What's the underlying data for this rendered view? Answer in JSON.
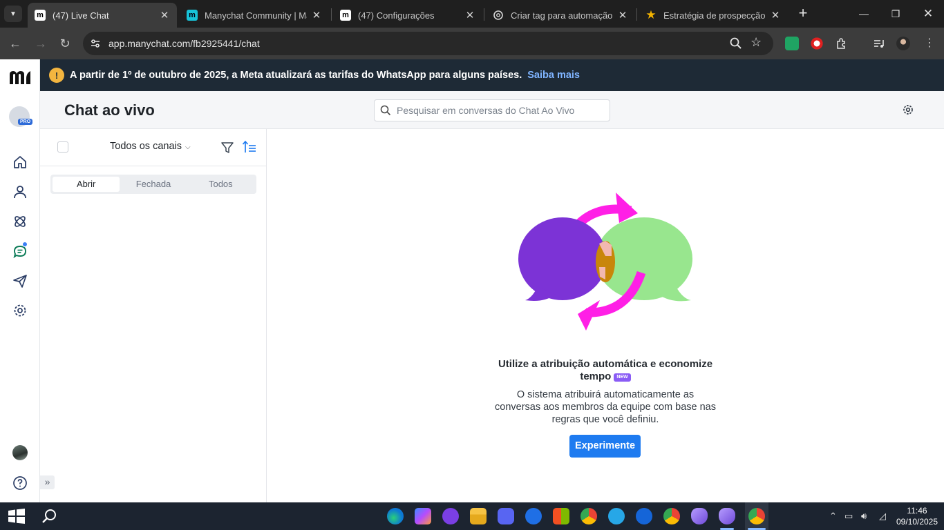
{
  "browser": {
    "tabs": [
      {
        "title": "(47) Live Chat",
        "favicon": "manychat-logo-icon",
        "active": true
      },
      {
        "title": "Manychat Community | Man",
        "favicon": "manychat-community-icon",
        "active": false
      },
      {
        "title": "(47) Configurações",
        "favicon": "manychat-logo-icon",
        "active": false
      },
      {
        "title": "Criar tag para automação",
        "favicon": "chatgpt-icon",
        "active": false
      },
      {
        "title": "Estratégia de prospecção em",
        "favicon": "star-icon",
        "active": false
      }
    ],
    "url": "app.manychat.com/fb2925441/chat",
    "colors": {
      "frame": "#1f1f1f",
      "toolbar": "#3c3c3c"
    }
  },
  "banner": {
    "text": "A partir de 1º de outubro de 2025, a Meta atualizará as tarifas do WhatsApp para alguns países.",
    "link": "Saiba mais"
  },
  "sidebar": {
    "pro_badge": "PRO",
    "items": [
      {
        "name": "home-icon"
      },
      {
        "name": "contacts-icon"
      },
      {
        "name": "automation-icon"
      },
      {
        "name": "live-chat-icon",
        "active": true,
        "notification": true
      },
      {
        "name": "broadcast-icon"
      },
      {
        "name": "settings-icon"
      }
    ]
  },
  "header": {
    "title": "Chat ao vivo",
    "search_placeholder": "Pesquisar em conversas do Chat Ao Vivo"
  },
  "list": {
    "channel_filter": "Todos os canais",
    "tabs": [
      "Abrir",
      "Fechada",
      "Todos"
    ],
    "active_tab": 0
  },
  "empty_state": {
    "title": "Utilize a atribuição automática e economize tempo",
    "badge": "NEW",
    "description": "O sistema atribuirá automaticamente as conversas aos membros da equipe com base nas regras que você definiu.",
    "button": "Experimente",
    "colors": {
      "purple": "#7c33d6",
      "green": "#98e68e",
      "magenta": "#ff1fe6",
      "button": "#1e7bf0"
    }
  },
  "taskbar": {
    "time": "11:46",
    "date": "09/10/2025"
  }
}
